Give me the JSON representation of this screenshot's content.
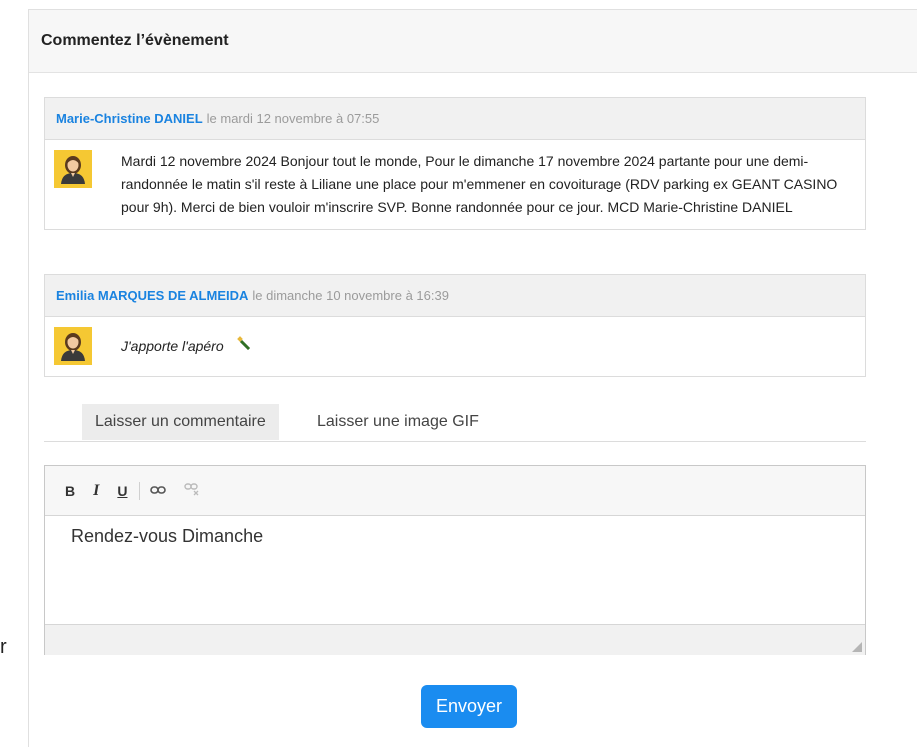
{
  "stray_char": "r",
  "panel": {
    "title": "Commentez l’évènement"
  },
  "comments": [
    {
      "author": "Marie-Christine DANIEL",
      "date": "le mardi 12 novembre à 07:55",
      "text": "Mardi 12 novembre 2024 Bonjour tout le monde, Pour le dimanche 17 novembre 2024 partante pour une demi- randonnée le matin s'il reste à Liliane une place pour m'emmener en covoiturage (RDV parking ex GEANT CASINO pour 9h). Merci de bien vouloir m'inscrire SVP. Bonne randonnée pour ce jour. MCD Marie-Christine DANIEL"
    },
    {
      "author": "Emilia MARQUES DE ALMEIDA",
      "date": "le dimanche 10 novembre à 16:39",
      "text": "J'apporte l'apéro"
    }
  ],
  "tabs": {
    "comment": "Laisser un commentaire",
    "gif": "Laisser une image GIF"
  },
  "toolbar": {
    "bold": "B",
    "italic": "I",
    "underline": "U"
  },
  "editor": {
    "content": "Rendez-vous Dimanche"
  },
  "send_label": "Envoyer",
  "colors": {
    "author": "#1a83e0",
    "button": "#1a8cf0",
    "avatar_bg": "#f5c833"
  }
}
